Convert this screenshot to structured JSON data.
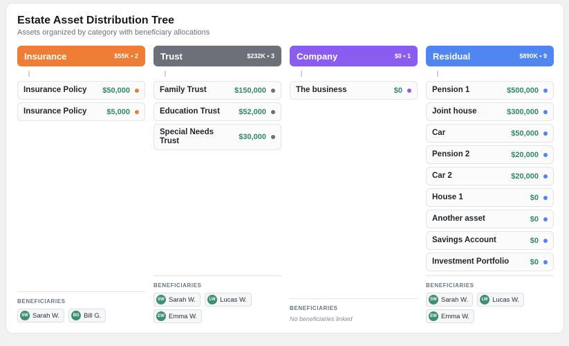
{
  "header": {
    "title": "Estate Asset Distribution Tree",
    "subtitle": "Assets organized by category with beneficiary allocations"
  },
  "beneficiaries_label": "BENEFICIARIES",
  "columns": [
    {
      "name": "Insurance",
      "meta": "$55K • 2",
      "color": "#ee7d35",
      "assets": [
        {
          "name": "Insurance Policy",
          "value": "$50,000"
        },
        {
          "name": "Insurance Policy",
          "value": "$5,000"
        }
      ],
      "beneficiaries": [
        {
          "initials": "SW",
          "name": "Sarah W."
        },
        {
          "initials": "BG",
          "name": "Bill G."
        }
      ]
    },
    {
      "name": "Trust",
      "meta": "$232K • 3",
      "color": "#6b7079",
      "assets": [
        {
          "name": "Family Trust",
          "value": "$150,000"
        },
        {
          "name": "Education Trust",
          "value": "$52,000"
        },
        {
          "name": "Special Needs Trust",
          "value": "$30,000"
        }
      ],
      "beneficiaries": [
        {
          "initials": "SW",
          "name": "Sarah W."
        },
        {
          "initials": "LW",
          "name": "Lucas W."
        },
        {
          "initials": "EW",
          "name": "Emma W."
        }
      ]
    },
    {
      "name": "Company",
      "meta": "$0 • 1",
      "color": "#8b5cf0",
      "assets": [
        {
          "name": "The business",
          "value": "$0"
        }
      ],
      "beneficiaries": [],
      "no_beneficiaries_text": "No beneficiaries linked"
    },
    {
      "name": "Residual",
      "meta": "$890K • 9",
      "color": "#4f86f0",
      "assets": [
        {
          "name": "Pension 1",
          "value": "$500,000"
        },
        {
          "name": "Joint house",
          "value": "$300,000"
        },
        {
          "name": "Car",
          "value": "$50,000"
        },
        {
          "name": "Pension 2",
          "value": "$20,000"
        },
        {
          "name": "Car 2",
          "value": "$20,000"
        },
        {
          "name": "House 1",
          "value": "$0"
        },
        {
          "name": "Another asset",
          "value": "$0"
        },
        {
          "name": "Savings Account",
          "value": "$0"
        },
        {
          "name": "Investment Portfolio",
          "value": "$0"
        }
      ],
      "beneficiaries": [
        {
          "initials": "SW",
          "name": "Sarah W."
        },
        {
          "initials": "LW",
          "name": "Lucas W."
        },
        {
          "initials": "EW",
          "name": "Emma W."
        }
      ]
    }
  ]
}
